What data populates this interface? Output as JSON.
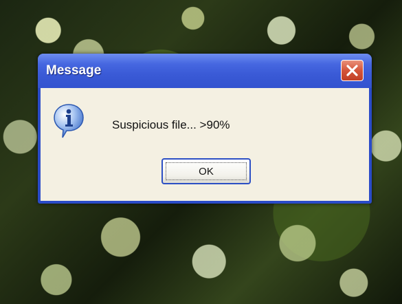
{
  "dialog": {
    "title": "Message",
    "icon": "info-icon",
    "message": "Suspicious file... >90%",
    "ok_label": "OK",
    "close_icon": "close-icon"
  },
  "colors": {
    "titlebar": "#3a5ad6",
    "body": "#f4f0e2",
    "close_button": "#d4553a",
    "focus_border": "#2c4fc4"
  }
}
